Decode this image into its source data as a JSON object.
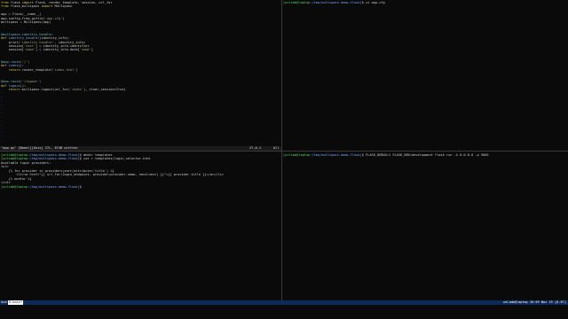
{
  "vim": {
    "code_lines": [
      {
        "t": [
          [
            "from",
            "kw"
          ],
          [
            " flask ",
            ""
          ],
          [
            "import",
            "kw"
          ],
          [
            " Flask, render_template, session, url_for",
            ""
          ]
        ]
      },
      {
        "t": [
          [
            "from",
            "kw"
          ],
          [
            " flask_multipass ",
            ""
          ],
          [
            "import",
            "kw"
          ],
          [
            " Multipass",
            ""
          ]
        ]
      },
      {
        "t": [
          [
            "",
            ""
          ]
        ]
      },
      {
        "t": [
          [
            "app = Flask(__name__)",
            ""
          ]
        ]
      },
      {
        "t": [
          [
            "app.config.from_pyfile(",
            ""
          ],
          [
            "'app.cfg'",
            "str"
          ],
          [
            ")",
            ""
          ]
        ]
      },
      {
        "t": [
          [
            "multipass = Multipass(app)",
            ""
          ]
        ]
      },
      {
        "t": [
          [
            "",
            ""
          ]
        ]
      },
      {
        "t": [
          [
            "",
            ""
          ]
        ]
      },
      {
        "t": [
          [
            "@multipass.identity_handler",
            "dec"
          ]
        ]
      },
      {
        "t": [
          [
            "def",
            "kw"
          ],
          [
            " ",
            ""
          ],
          [
            "identity_handler",
            "fn"
          ],
          [
            "(identity_info):",
            ""
          ]
        ]
      },
      {
        "t": [
          [
            "    print(",
            ""
          ],
          [
            "'identity handler'",
            "str"
          ],
          [
            ", identity_info)",
            ""
          ]
        ]
      },
      {
        "t": [
          [
            "    session[",
            ""
          ],
          [
            "'user'",
            "str"
          ],
          [
            "] = identity_info.identifier",
            ""
          ]
        ]
      },
      {
        "t": [
          [
            "    session[",
            ""
          ],
          [
            "'name'",
            "str"
          ],
          [
            "] = identity_info.data[",
            ""
          ],
          [
            "'name'",
            "str"
          ],
          [
            "]",
            ""
          ]
        ]
      },
      {
        "t": [
          [
            "",
            ""
          ]
        ]
      },
      {
        "t": [
          [
            "",
            ""
          ]
        ]
      },
      {
        "t": [
          [
            "@app.route(",
            "dec"
          ],
          [
            "'/'",
            "str"
          ],
          [
            ")",
            "dec"
          ]
        ]
      },
      {
        "t": [
          [
            "def",
            "kw"
          ],
          [
            " ",
            ""
          ],
          [
            "index",
            "fn"
          ],
          [
            "():",
            ""
          ]
        ]
      },
      {
        "t": [
          [
            "    ",
            ""
          ],
          [
            "return",
            "kw"
          ],
          [
            " render_template(",
            ""
          ],
          [
            "'index.html'",
            "str"
          ],
          [
            ")",
            ""
          ]
        ]
      },
      {
        "t": [
          [
            "",
            ""
          ]
        ]
      },
      {
        "t": [
          [
            "",
            ""
          ]
        ]
      },
      {
        "t": [
          [
            "@app.route(",
            "dec"
          ],
          [
            "'/logout'",
            "str"
          ],
          [
            ")",
            "dec"
          ]
        ]
      },
      {
        "t": [
          [
            "def",
            "kw"
          ],
          [
            " ",
            ""
          ],
          [
            "logout",
            "fn"
          ],
          [
            "():",
            ""
          ]
        ]
      },
      {
        "t": [
          [
            "    ",
            ""
          ],
          [
            "return",
            "kw"
          ],
          [
            " multipass.logout(url_for(",
            ""
          ],
          [
            "'index'",
            "str"
          ],
          [
            "), clear_session=True)",
            ""
          ]
        ]
      }
    ],
    "tilde_count": 13,
    "status_file": "\"app.py\" [Noeol][Unix] 27L, 674B written",
    "status_pos": "27,0-1",
    "status_pct": "All"
  },
  "top_right": {
    "lines": [
      {
        "user": "[unlimb@laptop",
        "path": ":/tmp/multipass-demo-flask]",
        "cmd": "$ vi app.cfg"
      }
    ]
  },
  "bottom_left": {
    "lines": [
      {
        "user": "[unlimb@laptop",
        "path": ":/tmp/multipass-demo-flask]",
        "cmd": "$ mkdir templates"
      },
      {
        "user": "[unlimb@laptop",
        "path": ":/tmp/multipass-demo-flask]",
        "cmd": "$ cat > templates/login_selector.html"
      },
      {
        "plain": "Available login providers:"
      },
      {
        "plain": "<ul>"
      },
      {
        "plain": "    {% for provider in providers|sort(attribute='title') %}"
      },
      {
        "plain": "        <li><a href=\"{{ url_for(login_endpoint, provider=provider.name, next=next) }}\">{{ provider.title }}</a></li>"
      },
      {
        "plain": "    {% endfor %}"
      },
      {
        "plain": "</ul>"
      },
      {
        "user": "[unlimb@laptop",
        "path": ":/tmp/multipass-demo-flask]",
        "cmd": "$ "
      }
    ]
  },
  "bottom_right": {
    "lines": [
      {
        "user": "[unlimb@laptop",
        "path": ":/tmp/multipass-demo-flask]",
        "cmd": "$ FLASK_DEBUG=1 FLASK_ENV=development flask run -h 0.0.0.0 -p 5005"
      }
    ]
  },
  "tmux": {
    "session": "Gxd",
    "window": "0:bash*",
    "right": "unlimb@laptop 16:59 Nov 25 [0.87]"
  }
}
